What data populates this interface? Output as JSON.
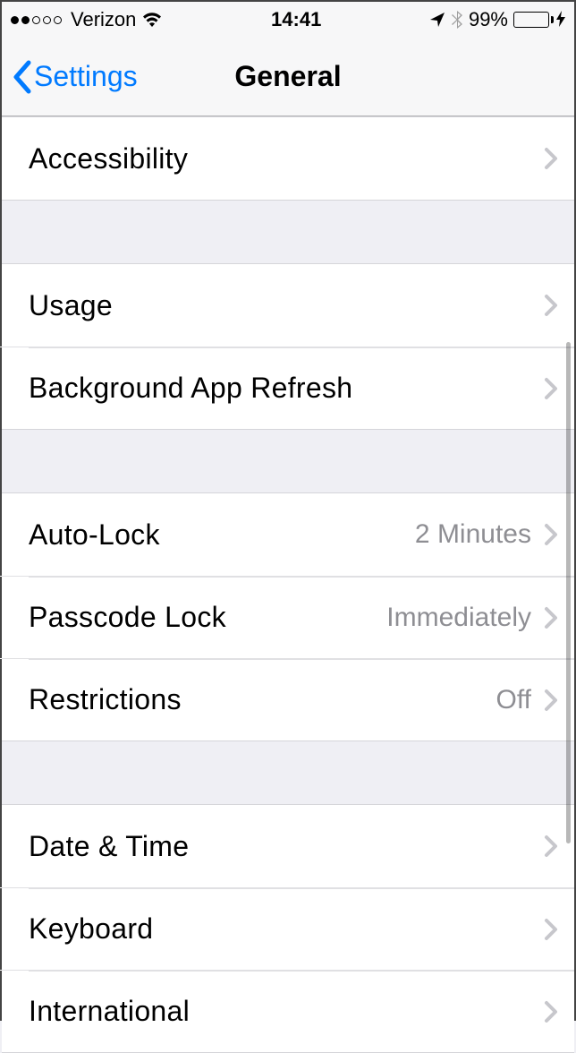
{
  "status": {
    "signal_filled": 2,
    "signal_total": 5,
    "carrier": "Verizon",
    "time": "14:41",
    "battery_pct": "99%"
  },
  "nav": {
    "back_label": "Settings",
    "title": "General"
  },
  "groups": [
    {
      "rows": [
        {
          "label": "Accessibility",
          "value": ""
        }
      ]
    },
    {
      "rows": [
        {
          "label": "Usage",
          "value": ""
        },
        {
          "label": "Background App Refresh",
          "value": ""
        }
      ]
    },
    {
      "rows": [
        {
          "label": "Auto-Lock",
          "value": "2 Minutes"
        },
        {
          "label": "Passcode Lock",
          "value": "Immediately"
        },
        {
          "label": "Restrictions",
          "value": "Off"
        }
      ]
    },
    {
      "rows": [
        {
          "label": "Date & Time",
          "value": ""
        },
        {
          "label": "Keyboard",
          "value": ""
        },
        {
          "label": "International",
          "value": ""
        }
      ]
    }
  ]
}
